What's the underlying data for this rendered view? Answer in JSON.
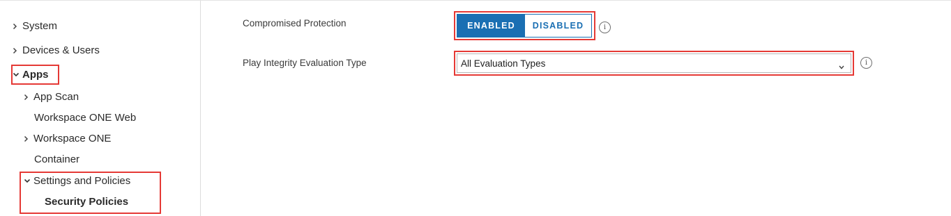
{
  "sidebar": {
    "items": [
      {
        "label": "System"
      },
      {
        "label": "Devices & Users"
      },
      {
        "label": "Apps"
      },
      {
        "label": "App Scan"
      },
      {
        "label": "Workspace ONE Web"
      },
      {
        "label": "Workspace ONE"
      },
      {
        "label": "Container"
      },
      {
        "label": "Settings and Policies"
      },
      {
        "label": "Security Policies"
      }
    ]
  },
  "settings": {
    "compromised_protection": {
      "label": "Compromised Protection",
      "enabled_label": "ENABLED",
      "disabled_label": "DISABLED",
      "selected": "ENABLED"
    },
    "play_integrity": {
      "label": "Play Integrity Evaluation Type",
      "value": "All Evaluation Types"
    }
  },
  "icons": {
    "info": "i"
  },
  "colors": {
    "accent": "#1a6fb3",
    "highlight": "#e53935"
  }
}
